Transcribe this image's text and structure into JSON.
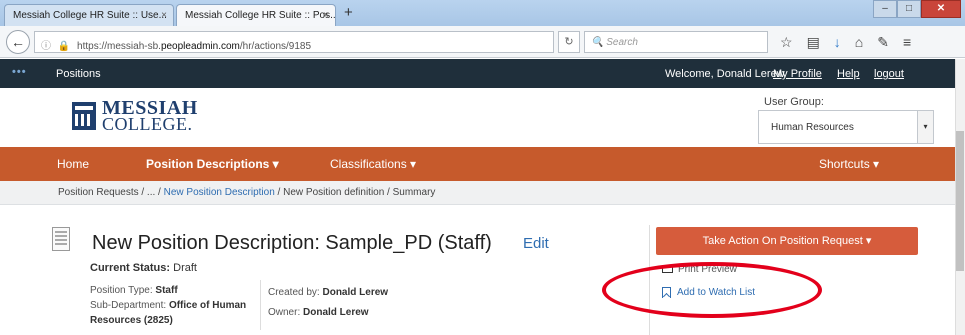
{
  "browser": {
    "tabs": [
      {
        "label": "Messiah College HR Suite :: Use...",
        "active": false
      },
      {
        "label": "Messiah College HR Suite :: Pos...",
        "active": true
      }
    ],
    "new_tab": "+",
    "tab_close": "×",
    "url_prefix": "https://messiah-sb.",
    "url_host": "peopleadmin.com",
    "url_path": "/hr/actions/9185",
    "search_placeholder": "Search"
  },
  "site_header": {
    "app_name": "Positions",
    "welcome": "Welcome, Donald Lerew",
    "links": [
      "My Profile",
      "Help",
      "logout"
    ]
  },
  "logo": {
    "line1": "MESSIAH",
    "line2": "COLLEGE."
  },
  "user_group": {
    "label": "User Group:",
    "value": "Human Resources"
  },
  "main_nav": {
    "home": "Home",
    "position_descriptions": "Position Descriptions ▾",
    "classifications": "Classifications ▾",
    "shortcuts": "Shortcuts ▾"
  },
  "breadcrumb": {
    "part1": "Position Requests  /  ...  / ",
    "link": "New Position Description",
    "part2": " /  New Position definition  /  Summary"
  },
  "content": {
    "title": "New Position Description: Sample_PD (Staff)",
    "edit": "Edit",
    "status_label": "Current Status:",
    "status_value": "Draft",
    "position_type_label": "Position Type:",
    "position_type_value": "Staff",
    "subdept_label": "Sub-Department:",
    "subdept_value": "Office of Human Resources (2825)",
    "created_by_label": "Created by:",
    "created_by_value": "Donald Lerew",
    "owner_label": "Owner:",
    "owner_value": "Donald Lerew"
  },
  "actions": {
    "take_action": "Take Action On Position Request ▾",
    "print_preview": "Print Preview",
    "watch_list": "Add to Watch List"
  },
  "colors": {
    "nav": "#c65a2c",
    "header": "#1f2f3b",
    "action": "#d65c3c",
    "highlight": "#e3001b"
  }
}
